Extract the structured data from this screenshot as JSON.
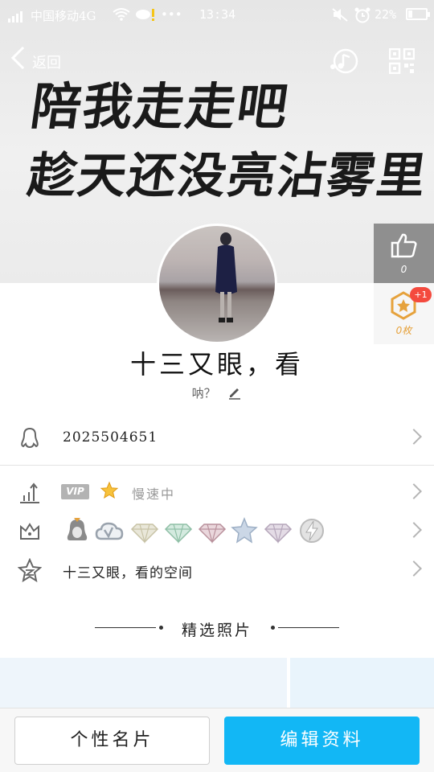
{
  "status_bar": {
    "carrier": "中国移动4G",
    "time": "13:34",
    "battery": "22%",
    "battery_level": 0.22
  },
  "nav": {
    "back_label": "返回",
    "music_icon": "music-icon",
    "qr_icon": "qr-code-icon"
  },
  "cover": {
    "line1": "陪我走走吧",
    "line2": "趁天还没亮沾雾里"
  },
  "side": {
    "likes_count": "0",
    "badge_count": "0枚",
    "badge_plus": "+1"
  },
  "profile": {
    "name": "十三又眼，看",
    "signature": "呐？"
  },
  "rows": {
    "qq_number": "2025504651",
    "vip_label": "VIP",
    "speed_text": "慢速中",
    "space_text": "十三又眼，看的空间"
  },
  "section": {
    "title": "精选照片"
  },
  "buttons": {
    "card": "个性名片",
    "edit": "编辑资料"
  },
  "colors": {
    "accent": "#12b7f5",
    "gold": "#e6a23c",
    "red_badge": "#f44a3e"
  }
}
